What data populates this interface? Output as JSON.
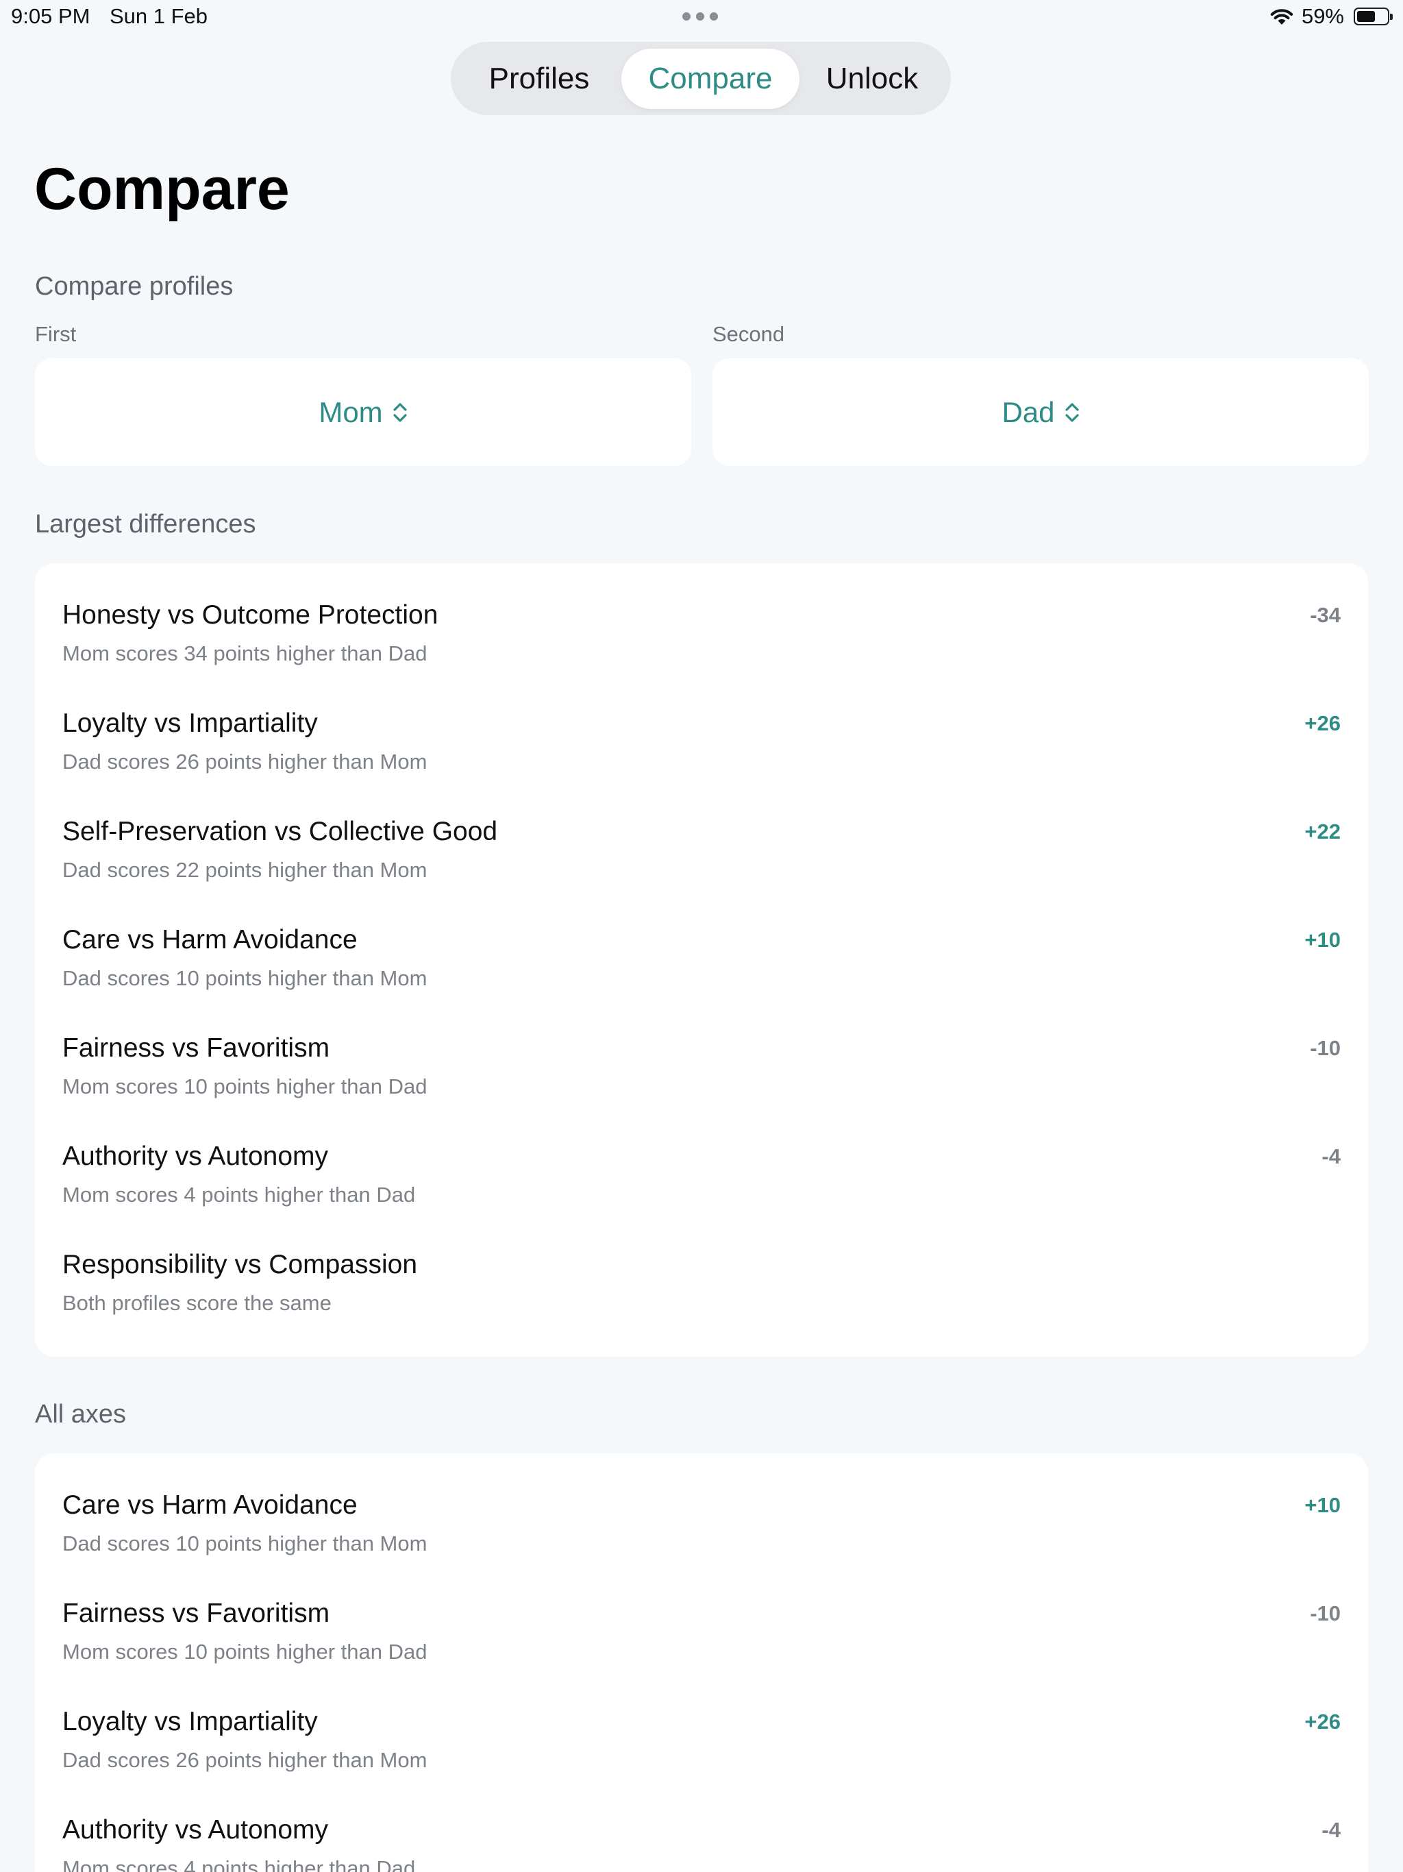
{
  "status": {
    "time": "9:05 PM",
    "date": "Sun 1 Feb",
    "battery": "59%"
  },
  "tabs": [
    {
      "label": "Profiles",
      "selected": false
    },
    {
      "label": "Compare",
      "selected": true
    },
    {
      "label": "Unlock",
      "selected": false
    }
  ],
  "page": {
    "title": "Compare"
  },
  "compare": {
    "section_label": "Compare profiles",
    "first_label": "First",
    "second_label": "Second",
    "first_value": "Mom",
    "second_value": "Dad"
  },
  "largest": {
    "section_label": "Largest differences",
    "rows": [
      {
        "title": "Honesty vs Outcome Protection",
        "subtitle": "Mom scores 34 points higher than Dad",
        "delta": "-34"
      },
      {
        "title": "Loyalty vs Impartiality",
        "subtitle": "Dad scores 26 points higher than Mom",
        "delta": "+26"
      },
      {
        "title": "Self-Preservation vs Collective Good",
        "subtitle": "Dad scores 22 points higher than Mom",
        "delta": "+22"
      },
      {
        "title": "Care vs Harm Avoidance",
        "subtitle": "Dad scores 10 points higher than Mom",
        "delta": "+10"
      },
      {
        "title": "Fairness vs Favoritism",
        "subtitle": "Mom scores 10 points higher than Dad",
        "delta": "-10"
      },
      {
        "title": "Authority vs Autonomy",
        "subtitle": "Mom scores 4 points higher than Dad",
        "delta": "-4"
      },
      {
        "title": "Responsibility vs Compassion",
        "subtitle": "Both profiles score the same",
        "delta": ""
      }
    ]
  },
  "all_axes": {
    "section_label": "All axes",
    "rows": [
      {
        "title": "Care vs Harm Avoidance",
        "subtitle": "Dad scores 10 points higher than Mom",
        "delta": "+10"
      },
      {
        "title": "Fairness vs Favoritism",
        "subtitle": "Mom scores 10 points higher than Dad",
        "delta": "-10"
      },
      {
        "title": "Loyalty vs Impartiality",
        "subtitle": "Dad scores 26 points higher than Mom",
        "delta": "+26"
      },
      {
        "title": "Authority vs Autonomy",
        "subtitle": "Mom scores 4 points higher than Dad",
        "delta": "-4"
      }
    ]
  },
  "colors": {
    "accent": "#2e8c87",
    "background": "#f5f8fb",
    "muted": "#7d8188"
  },
  "icons": {
    "wifi": "wifi-icon",
    "battery": "battery-icon",
    "picker_chevron": "chevron-up-down-icon"
  }
}
